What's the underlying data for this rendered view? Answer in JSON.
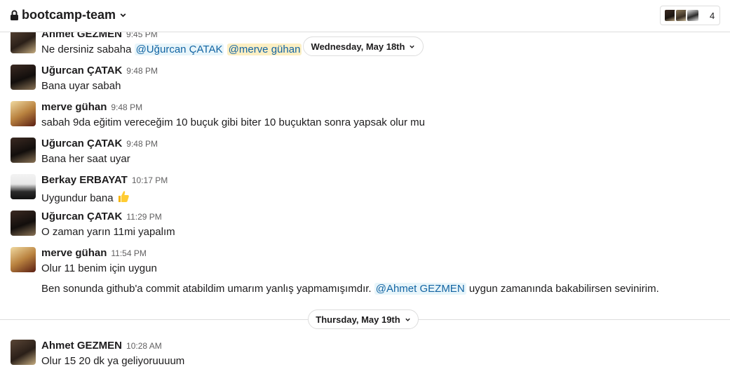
{
  "channel": {
    "name": "bootcamp-team",
    "member_count": "4"
  },
  "date_dividers": {
    "first": "Wednesday, May 18th",
    "second": "Thursday, May 19th"
  },
  "messages": [
    {
      "author": "Ahmet GEZMEN",
      "time": "9:45 PM",
      "text_before": "Ne dersiniz sabaha ",
      "mention1": "@Uğurcan ÇATAK",
      "mention2": "@merve gühan"
    },
    {
      "author": "Uğurcan ÇATAK",
      "time": "9:48 PM",
      "text": "Bana uyar sabah"
    },
    {
      "author": "merve gühan",
      "time": "9:48 PM",
      "text": "sabah 9da eğitim vereceğim 10 buçuk gibi biter 10 buçuktan sonra yapsak olur mu"
    },
    {
      "author": "Uğurcan ÇATAK",
      "time": "9:48 PM",
      "text": "Bana her saat uyar"
    },
    {
      "author": "Berkay ERBAYAT",
      "time": "10:17 PM",
      "text": "Uygundur bana",
      "emoji": "thumbs-up"
    },
    {
      "author": "Uğurcan ÇATAK",
      "time": "11:29 PM",
      "text": "O zaman yarın 11mi yapalım"
    },
    {
      "author": "merve gühan",
      "time": "11:54 PM",
      "text": "Olur 11 benim için uygun",
      "followup_before": "Ben sonunda github'a commit atabildim umarım yanlış yapmamışımdır. ",
      "followup_mention": "@Ahmet GEZMEN",
      "followup_after": " uygun zamanında bakabilirsen sevinirim."
    },
    {
      "author": "Ahmet GEZMEN",
      "time": "10:28 AM",
      "text": "Olur 15 20 dk ya geliyoruuuum"
    }
  ],
  "colors": {
    "link": "#1264a3",
    "mention_bg": "#e8f5fa",
    "self_mention_bg": "#fcefc3",
    "divider": "#dddddd"
  }
}
